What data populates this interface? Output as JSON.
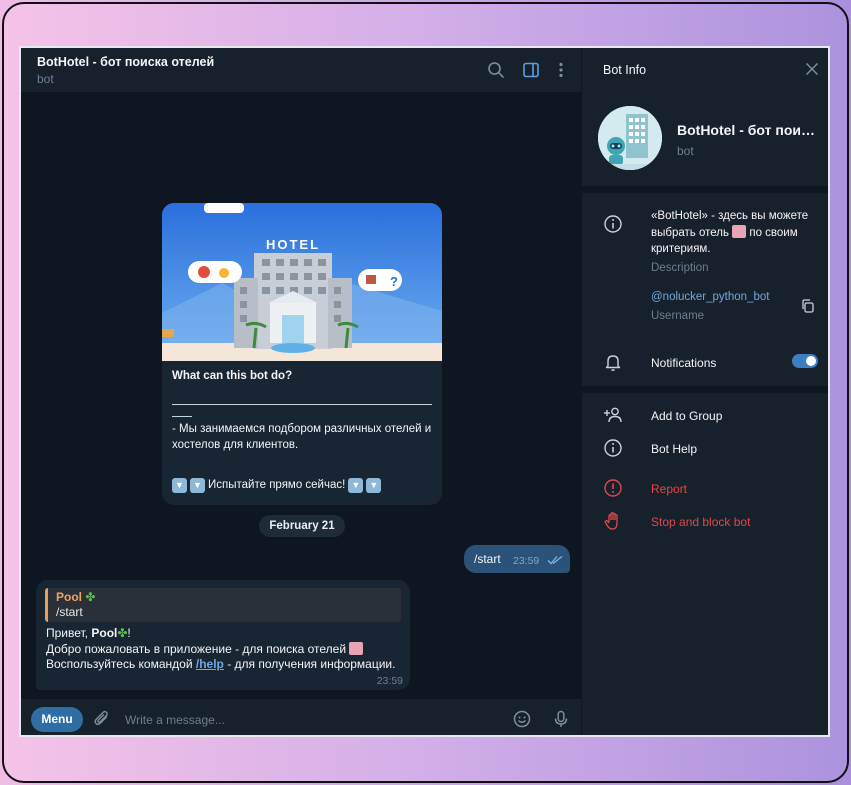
{
  "chat": {
    "title": "BotHotel - бот поиска отелей",
    "subtitle": "bot"
  },
  "welcome_card": {
    "image_sign": "HOTEL",
    "heading": "What can this bot do?",
    "description": "- Мы занимаемся подбором различных отелей и хостелов для клиентов.",
    "try_now": "Испытайте прямо сейчас!"
  },
  "date_separator": "February 21",
  "outgoing": {
    "text": "/start",
    "time": "23:59"
  },
  "incoming": {
    "reply_name": "Pool",
    "reply_text": "/start",
    "greeting_prefix": "Привет, ",
    "greeting_name": "Pool",
    "greeting_suffix": "!",
    "line2": "Добро пожаловать в приложение - для поиска отелей",
    "line3_prefix": "Воспользуйтесь командой ",
    "line3_link": "/help",
    "line3_suffix": " - для получения информации.",
    "time": "23:59"
  },
  "composer": {
    "menu_label": "Menu",
    "placeholder": "Write a message..."
  },
  "bot_info": {
    "header": "Bot Info",
    "name": "BotHotel - бот поиска отелей",
    "subtitle": "bot",
    "description_before": "«BotHotel» - здесь вы можете выбрать отель",
    "description_after": "по своим критериям.",
    "description_label": "Description",
    "username": "@nolucker_python_bot",
    "username_label": "Username",
    "notifications": "Notifications",
    "notifications_enabled": true,
    "add_to_group": "Add to Group",
    "bot_help": "Bot Help",
    "report": "Report",
    "stop_block": "Stop and block bot"
  },
  "colors": {
    "background": "#0e1621",
    "panel": "#17212b",
    "bubble_in": "#182533",
    "bubble_out": "#2b5278",
    "accent": "#2f6ea5",
    "link": "#71a7e0",
    "danger": "#e0474c",
    "quote_accent": "#e6a05b"
  }
}
